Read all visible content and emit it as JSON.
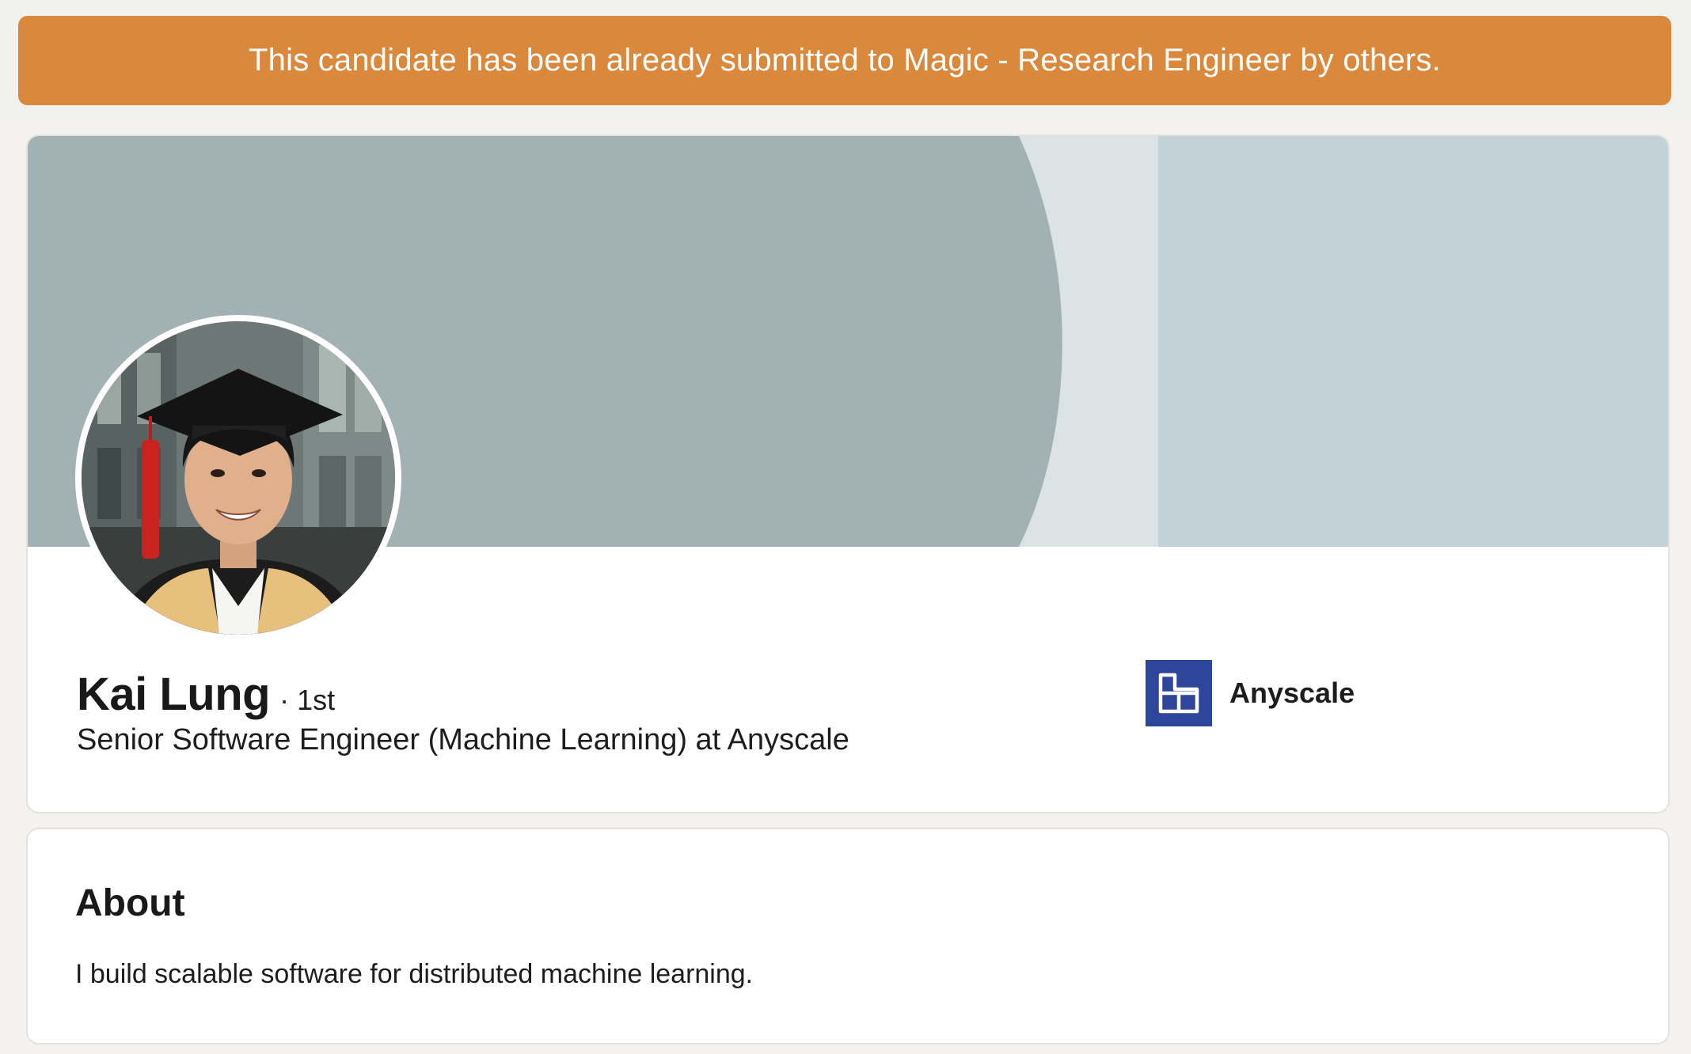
{
  "banner": {
    "message": "This candidate has been already submitted to Magic - Research Engineer by others."
  },
  "profile": {
    "name": "Kai Lung",
    "connection_degree": "· 1st",
    "headline": "Senior Software Engineer (Machine Learning) at Anyscale",
    "company": {
      "name": "Anyscale",
      "logo_icon": "anyscale-logo-icon",
      "logo_color": "#2d469b"
    },
    "cover_colors": {
      "primary": "#a2b1b4",
      "light": "#dbe3e5",
      "right": "#c3d2d6"
    },
    "avatar_icon": "profile-photo"
  },
  "about": {
    "title": "About",
    "text": "I build scalable software for distributed machine learning."
  },
  "colors": {
    "banner_bg": "#d9883c",
    "page_bg": "#f3f2ef",
    "card_bg": "#ffffff"
  }
}
